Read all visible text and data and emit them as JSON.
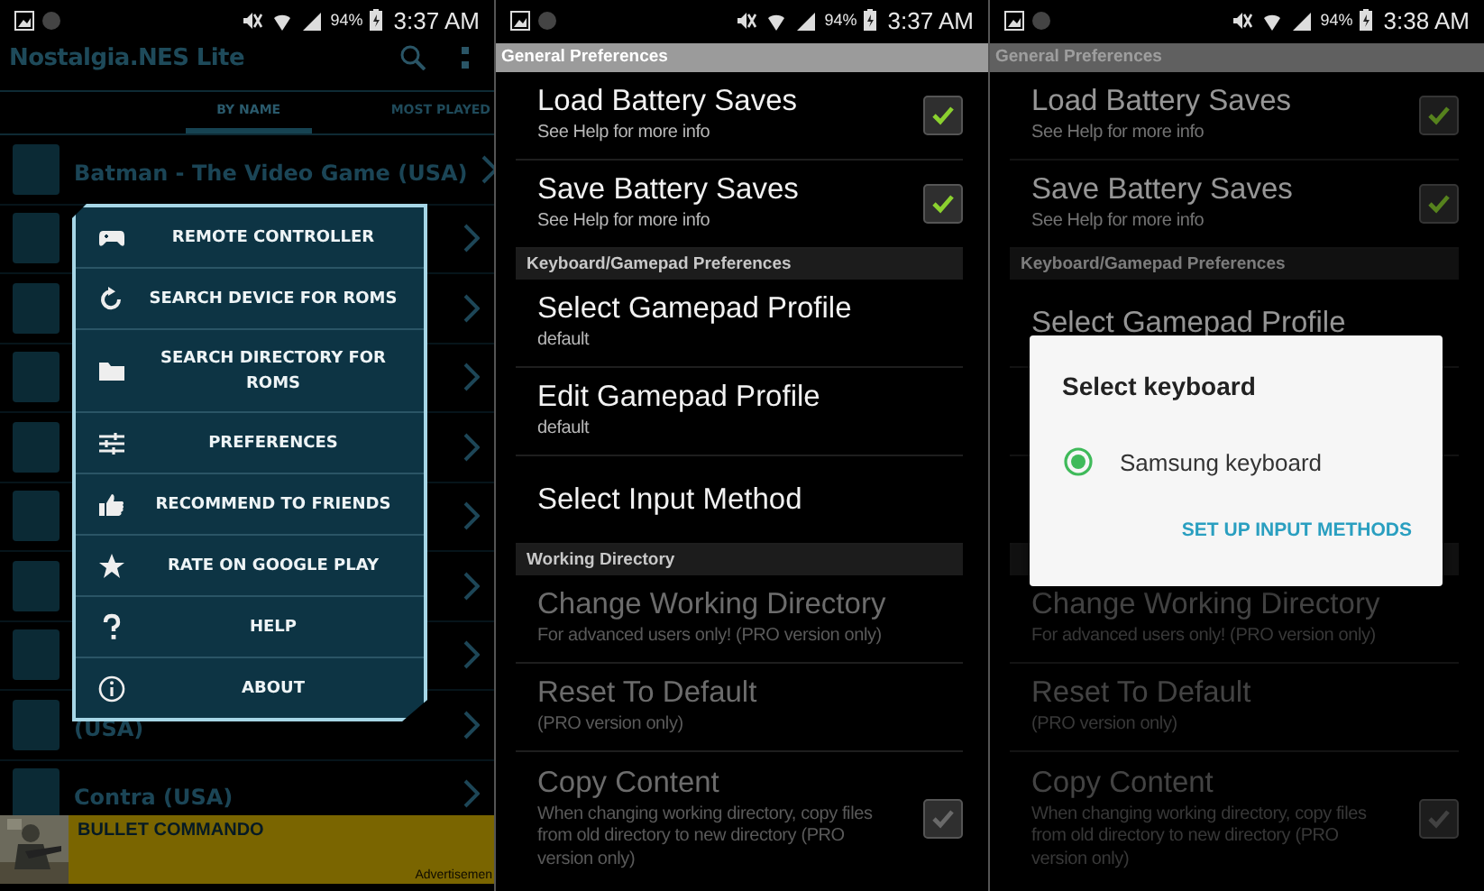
{
  "screens": [
    {
      "kind": "game_list",
      "status_bar": {
        "battery": "94%",
        "time": "3:37 AM"
      },
      "app_title": "Nostalgia.NES Lite",
      "tabs": [
        {
          "label": "BY NAME",
          "selected": true
        },
        {
          "label": "MOST PLAYED",
          "selected": false
        }
      ],
      "games": [
        {
          "kind": "row",
          "title": "Batman - The Video Game (USA)"
        },
        {
          "kind": "covered"
        },
        {
          "kind": "covered"
        },
        {
          "kind": "covered"
        },
        {
          "kind": "covered"
        },
        {
          "kind": "covered"
        },
        {
          "kind": "covered"
        },
        {
          "kind": "covered"
        },
        {
          "kind": "row",
          "title": "(USA)"
        },
        {
          "kind": "row",
          "title": "Contra (USA)"
        }
      ],
      "menu": [
        {
          "label": "REMOTE CONTROLLER"
        },
        {
          "label": "SEARCH DEVICE FOR ROMS"
        },
        {
          "label": "SEARCH DIRECTORY FOR ROMS"
        },
        {
          "label": "PREFERENCES"
        },
        {
          "label": "RECOMMEND TO FRIENDS"
        },
        {
          "label": "RATE ON GOOGLE PLAY"
        },
        {
          "label": "HELP"
        },
        {
          "label": "ABOUT"
        }
      ],
      "ad": {
        "title": "BULLET COMMANDO",
        "label": "Advertisemen"
      }
    },
    {
      "kind": "preferences",
      "status_bar": {
        "battery": "94%",
        "time": "3:37 AM"
      },
      "items": [
        {
          "kind": "header",
          "title": "General Preferences"
        },
        {
          "kind": "checkbox",
          "title": "Load Battery Saves",
          "summary": "See Help for more info",
          "checked": true,
          "disabled": false
        },
        {
          "kind": "checkbox",
          "title": "Save Battery Saves",
          "summary": "See Help for more info",
          "checked": true,
          "disabled": false
        },
        {
          "kind": "header",
          "title": "Keyboard/Gamepad Preferences"
        },
        {
          "kind": "plain",
          "title": "Select Gamepad Profile",
          "summary": "default",
          "disabled": false
        },
        {
          "kind": "plain",
          "title": "Edit Gamepad Profile",
          "summary": "default",
          "disabled": false
        },
        {
          "kind": "plain",
          "title": "Select Input Method",
          "disabled": false
        },
        {
          "kind": "header",
          "title": "Working Directory"
        },
        {
          "kind": "plain",
          "title": "Change Working Directory",
          "summary": "For advanced users only! (PRO version only)",
          "disabled": true
        },
        {
          "kind": "plain",
          "title": "Reset To Default",
          "summary": "(PRO version only)",
          "disabled": true
        },
        {
          "kind": "checkbox",
          "title": "Copy Content",
          "summary": "When changing working directory, copy files from old directory to new directory (PRO version only)",
          "checked": true,
          "disabled": true
        }
      ]
    },
    {
      "kind": "preferences",
      "status_bar": {
        "battery": "94%",
        "time": "3:38 AM"
      },
      "items": [
        {
          "kind": "header",
          "title": "General Preferences"
        },
        {
          "kind": "checkbox",
          "title": "Load Battery Saves",
          "summary": "See Help for more info",
          "checked": true,
          "disabled": false
        },
        {
          "kind": "checkbox",
          "title": "Save Battery Saves",
          "summary": "See Help for more info",
          "checked": true,
          "disabled": false
        },
        {
          "kind": "header",
          "title": "Keyboard/Gamepad Preferences"
        },
        {
          "kind": "plain",
          "title": "Select Gamepad Profile",
          "disabled": false
        },
        {
          "kind": "covered"
        },
        {
          "kind": "covered"
        },
        {
          "kind": "header"
        },
        {
          "kind": "plain",
          "title": "Change Working Directory",
          "summary": "For advanced users only! (PRO version only)",
          "disabled": true
        },
        {
          "kind": "plain",
          "title": "Reset To Default",
          "summary": "(PRO version only)",
          "disabled": true
        },
        {
          "kind": "checkbox",
          "title": "Copy Content",
          "summary": "When changing working directory, copy files from old directory to new directory (PRO version only)",
          "checked": true,
          "disabled": true
        }
      ],
      "dialog": {
        "title": "Select keyboard",
        "options": [
          {
            "label": "Samsung keyboard",
            "selected": true
          }
        ],
        "action": "SET UP INPUT METHODS"
      }
    }
  ]
}
